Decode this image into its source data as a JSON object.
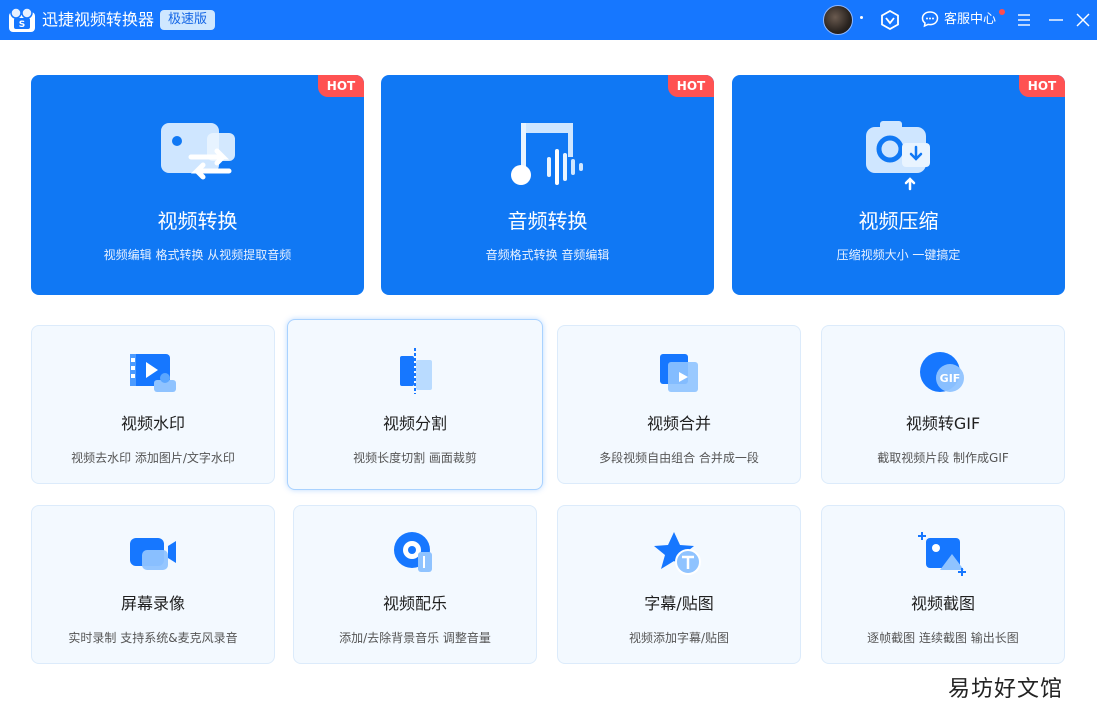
{
  "app": {
    "title": "迅捷视频转换器",
    "badge": "极速版"
  },
  "titlebar": {
    "avatar_dot": ".",
    "service_label": "客服中心",
    "icons": [
      "app-logo-icon",
      "vip-icon",
      "chat-icon",
      "menu-icon",
      "minimize-icon",
      "close-icon"
    ]
  },
  "features": [
    {
      "name": "video-convert",
      "badge": "HOT",
      "title": "视频转换",
      "desc": "视频编辑 格式转换 从视频提取音频",
      "icon": "video-convert-icon"
    },
    {
      "name": "audio-convert",
      "badge": "HOT",
      "title": "音频转换",
      "desc": "音频格式转换 音频编辑",
      "icon": "music-icon"
    },
    {
      "name": "video-compress",
      "badge": "HOT",
      "title": "视频压缩",
      "desc": "压缩视频大小 一键搞定",
      "icon": "camera-compress-icon"
    }
  ],
  "tools": [
    {
      "name": "video-watermark",
      "title": "视频水印",
      "desc": "视频去水印 添加图片/文字水印",
      "icon": "watermark-icon"
    },
    {
      "name": "video-split",
      "title": "视频分割",
      "desc": "视频长度切割 画面裁剪",
      "icon": "split-icon"
    },
    {
      "name": "video-merge",
      "title": "视频合并",
      "desc": "多段视频自由组合 合并成一段",
      "icon": "merge-icon"
    },
    {
      "name": "video-to-gif",
      "title": "视频转GIF",
      "desc": "截取视频片段 制作成GIF",
      "icon": "gif-icon",
      "icon_text": "GIF"
    },
    {
      "name": "screen-record",
      "title": "屏幕录像",
      "desc": "实时录制 支持系统&麦克风录音",
      "icon": "screen-record-icon"
    },
    {
      "name": "video-music",
      "title": "视频配乐",
      "desc": "添加/去除背景音乐 调整音量",
      "icon": "music-disc-icon"
    },
    {
      "name": "subtitle-sticker",
      "title": "字幕/贴图",
      "desc": "视频添加字幕/贴图",
      "icon": "subtitle-star-icon"
    },
    {
      "name": "video-screenshot",
      "title": "视频截图",
      "desc": "逐帧截图 连续截图 输出长图",
      "icon": "screenshot-icon"
    }
  ],
  "watermark_text": "易坊好文馆",
  "colors": {
    "primary": "#1677ff",
    "card_blue": "#1078f4",
    "hot_red": "#ff5252",
    "tool_bg": "#f3f9ff"
  }
}
